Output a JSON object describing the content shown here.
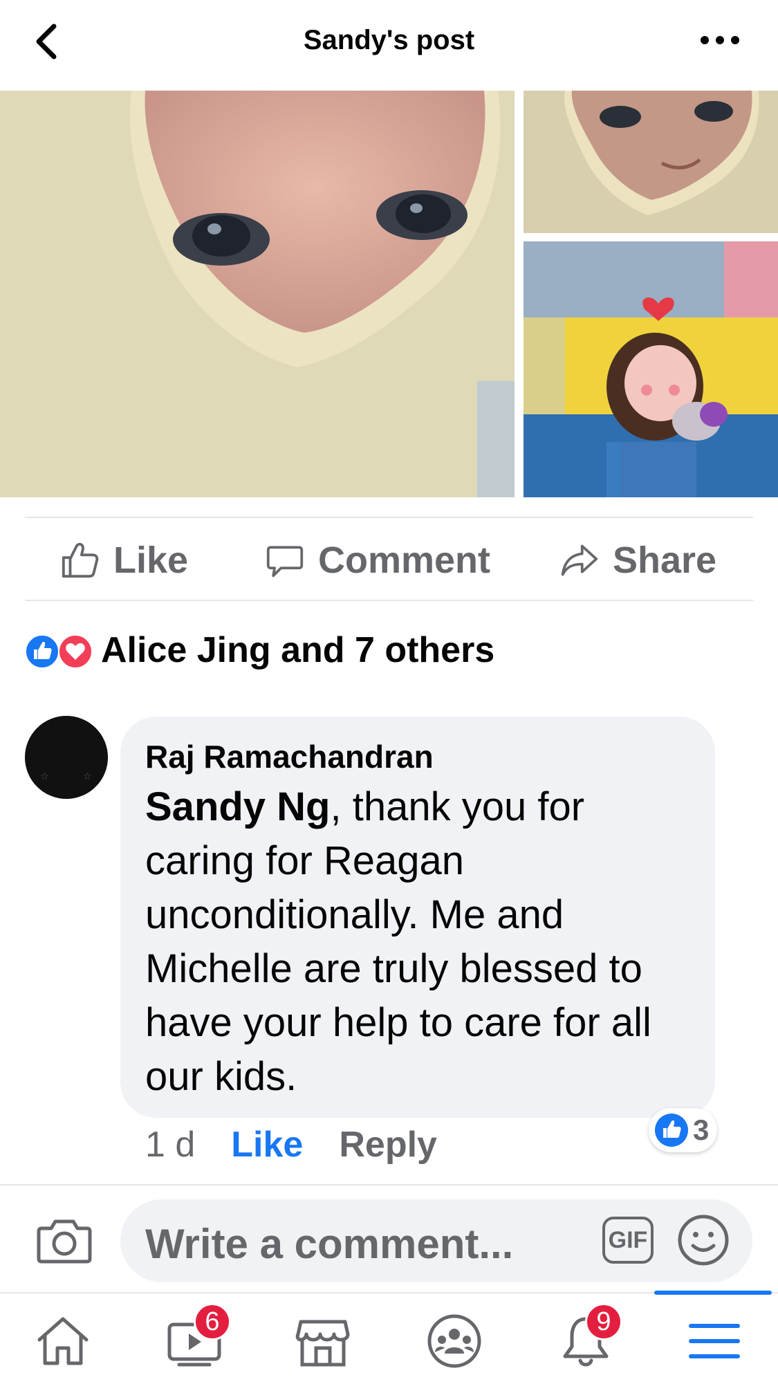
{
  "header": {
    "title": "Sandy's post",
    "back_icon": "chevron-left-icon",
    "more_icon": "more-dots-icon"
  },
  "photos": {
    "count": 3
  },
  "actions": {
    "like_label": "Like",
    "comment_label": "Comment",
    "share_label": "Share"
  },
  "reactions": {
    "summary": "Alice Jing and 7 others",
    "icons": [
      "like-reaction-icon",
      "love-reaction-icon"
    ]
  },
  "comment": {
    "author": "Raj Ramachandran",
    "mention": "Sandy Ng",
    "text": ", thank you for caring for Reagan unconditionally. Me and Michelle are truly blessed to have your help to care for all our kids.",
    "like_count": "3",
    "time": "1 d",
    "like_action": "Like",
    "reply_action": "Reply"
  },
  "composer": {
    "placeholder": "Write a comment...",
    "gif_label": "GIF"
  },
  "bottom_nav": {
    "watch_badge": "6",
    "notifications_badge": "9",
    "active": "menu"
  },
  "colors": {
    "accent": "#1877f2",
    "badge": "#e41e3f",
    "muted": "#65676b",
    "bubble": "#f0f2f5"
  }
}
